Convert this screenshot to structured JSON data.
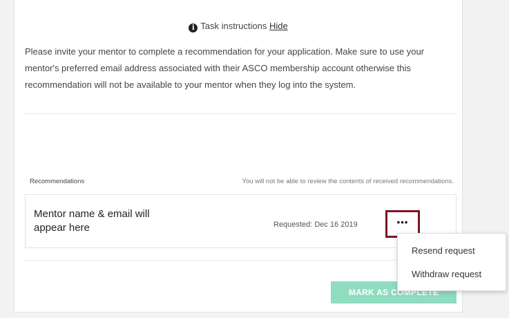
{
  "task": {
    "header_label": "Task instructions",
    "hide_link": "Hide",
    "instructions": "Please invite your mentor to complete a recommendation for your application. Make sure to use your mentor's preferred email address associated with their ASCO membership account otherwise this recommendation will not be available to your mentor when they log into the system."
  },
  "recommendations": {
    "section_label": "Recommendations",
    "note": "You will not be able to review the contents of received recommendations.",
    "items": [
      {
        "mentor_placeholder": "Mentor name & email will appear here",
        "requested": "Requested: Dec 16 2019",
        "more_button": "•••"
      }
    ]
  },
  "menu": {
    "items": [
      "Resend request",
      "Withdraw request"
    ]
  },
  "actions": {
    "mark_complete": "MARK AS COMPLETE"
  },
  "colors": {
    "highlight_border": "#7a1522",
    "complete_button": "#8fdcc0"
  },
  "icons": {
    "info": "info-icon"
  }
}
